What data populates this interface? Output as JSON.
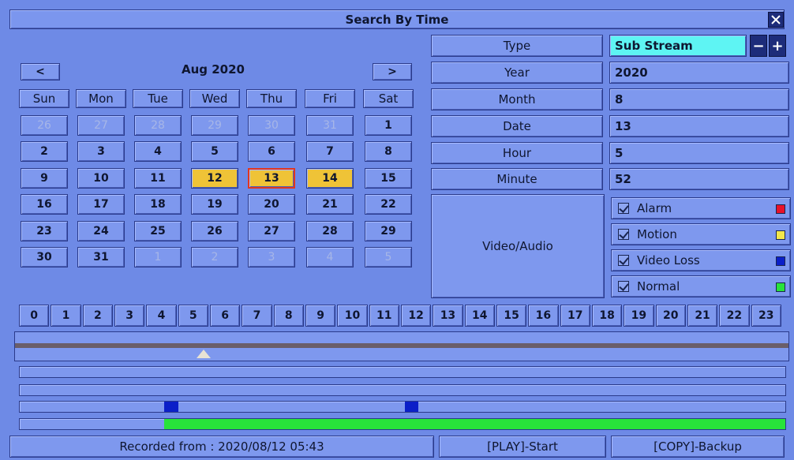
{
  "window": {
    "title": "Search By Time"
  },
  "calendar": {
    "prev_label": "<",
    "next_label": ">",
    "month_label": "Aug 2020",
    "weekdays": [
      "Sun",
      "Mon",
      "Tue",
      "Wed",
      "Thu",
      "Fri",
      "Sat"
    ],
    "weeks": [
      [
        {
          "d": "26",
          "s": "dim"
        },
        {
          "d": "27",
          "s": "dim"
        },
        {
          "d": "28",
          "s": "dim"
        },
        {
          "d": "29",
          "s": "dim"
        },
        {
          "d": "30",
          "s": "dim"
        },
        {
          "d": "31",
          "s": "dim"
        },
        {
          "d": "1",
          "s": ""
        }
      ],
      [
        {
          "d": "2",
          "s": ""
        },
        {
          "d": "3",
          "s": ""
        },
        {
          "d": "4",
          "s": ""
        },
        {
          "d": "5",
          "s": ""
        },
        {
          "d": "6",
          "s": ""
        },
        {
          "d": "7",
          "s": ""
        },
        {
          "d": "8",
          "s": ""
        }
      ],
      [
        {
          "d": "9",
          "s": ""
        },
        {
          "d": "10",
          "s": ""
        },
        {
          "d": "11",
          "s": ""
        },
        {
          "d": "12",
          "s": "rec"
        },
        {
          "d": "13",
          "s": "sel"
        },
        {
          "d": "14",
          "s": "rec"
        },
        {
          "d": "15",
          "s": ""
        }
      ],
      [
        {
          "d": "16",
          "s": ""
        },
        {
          "d": "17",
          "s": ""
        },
        {
          "d": "18",
          "s": ""
        },
        {
          "d": "19",
          "s": ""
        },
        {
          "d": "20",
          "s": ""
        },
        {
          "d": "21",
          "s": ""
        },
        {
          "d": "22",
          "s": ""
        }
      ],
      [
        {
          "d": "23",
          "s": ""
        },
        {
          "d": "24",
          "s": ""
        },
        {
          "d": "25",
          "s": ""
        },
        {
          "d": "26",
          "s": ""
        },
        {
          "d": "27",
          "s": ""
        },
        {
          "d": "28",
          "s": ""
        },
        {
          "d": "29",
          "s": ""
        }
      ],
      [
        {
          "d": "30",
          "s": ""
        },
        {
          "d": "31",
          "s": ""
        },
        {
          "d": "1",
          "s": "dim"
        },
        {
          "d": "2",
          "s": "dim"
        },
        {
          "d": "3",
          "s": "dim"
        },
        {
          "d": "4",
          "s": "dim"
        },
        {
          "d": "5",
          "s": "dim"
        }
      ]
    ]
  },
  "fields": {
    "type": {
      "label": "Type",
      "value": "Sub Stream"
    },
    "year": {
      "label": "Year",
      "value": "2020"
    },
    "month": {
      "label": "Month",
      "value": "8"
    },
    "date": {
      "label": "Date",
      "value": "13"
    },
    "hour": {
      "label": "Hour",
      "value": "5"
    },
    "minute": {
      "label": "Minute",
      "value": "52"
    }
  },
  "stepper": {
    "minus": "−",
    "plus": "+"
  },
  "video_audio_label": "Video/Audio",
  "legend": [
    {
      "label": "Alarm",
      "color": "#e8122a"
    },
    {
      "label": "Motion",
      "color": "#f2e64a"
    },
    {
      "label": "Video Loss",
      "color": "#0b1fc8"
    },
    {
      "label": "Normal",
      "color": "#28e33a"
    }
  ],
  "hours": [
    "0",
    "1",
    "2",
    "3",
    "4",
    "5",
    "6",
    "7",
    "8",
    "9",
    "10",
    "11",
    "12",
    "13",
    "14",
    "15",
    "16",
    "17",
    "18",
    "19",
    "20",
    "21",
    "22",
    "23"
  ],
  "timeline": {
    "cursor_hour_fraction": 0.243,
    "tracks": [
      {
        "segments": []
      },
      {
        "segments": []
      },
      {
        "segments": [
          {
            "from": 0.189,
            "to": 0.207,
            "color": "#0b1fc8"
          },
          {
            "from": 0.503,
            "to": 0.521,
            "color": "#0b1fc8"
          }
        ]
      },
      {
        "segments": [
          {
            "from": 0.189,
            "to": 1.0,
            "color": "#28e33a"
          }
        ]
      }
    ]
  },
  "status": {
    "recorded_from": "Recorded from : 2020/08/12 05:43",
    "play": "[PLAY]-Start",
    "copy": "[COPY]-Backup"
  }
}
